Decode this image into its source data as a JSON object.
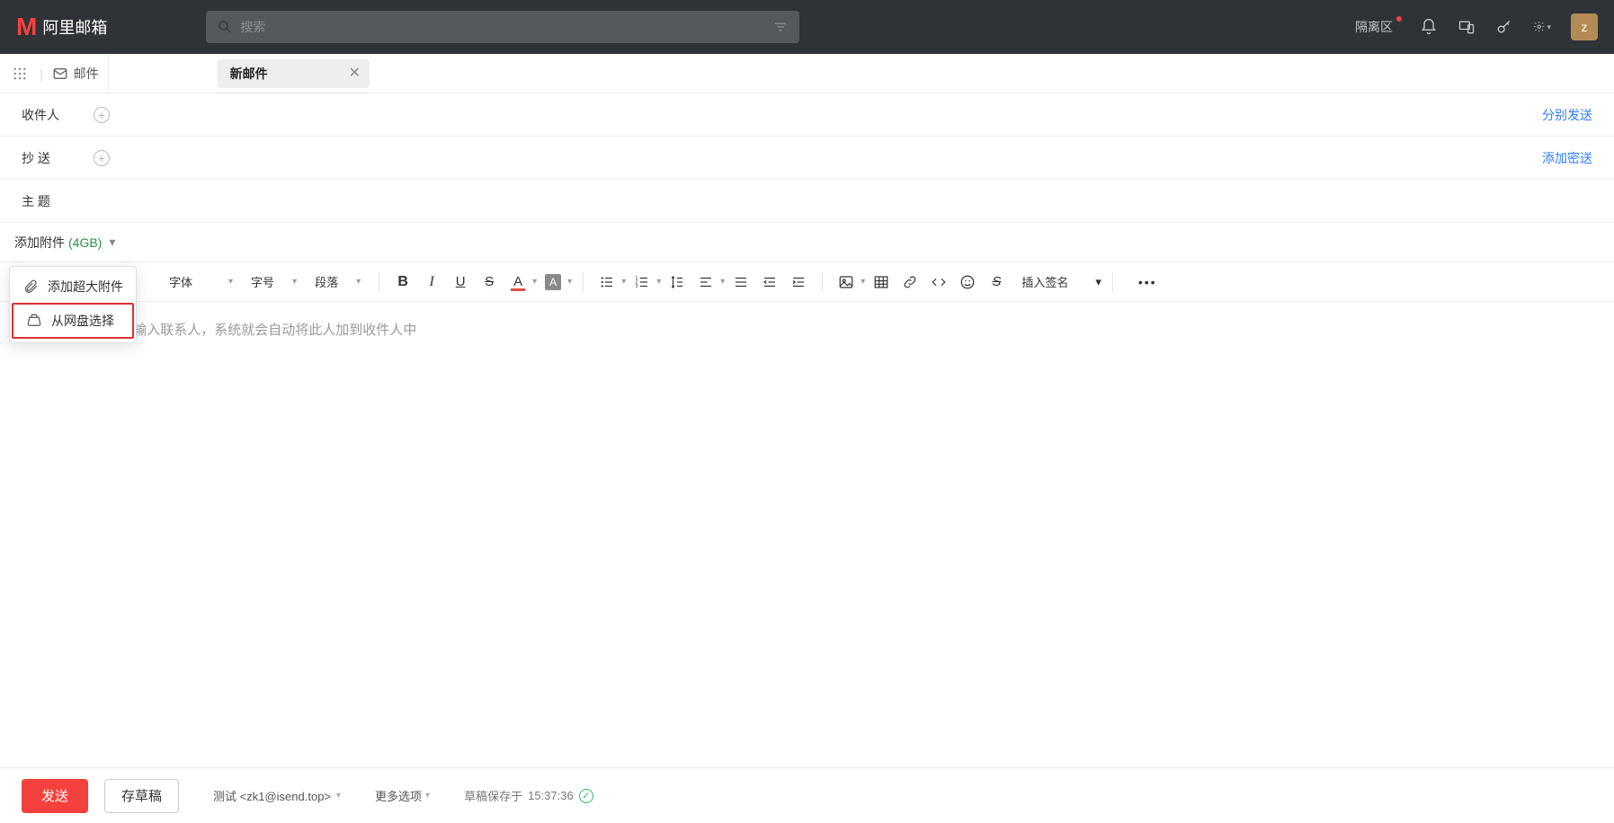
{
  "header": {
    "brand_text": "阿里邮箱",
    "search_placeholder": "搜索",
    "quarantine_label": "隔离区",
    "avatar_letter": "z"
  },
  "tabs": {
    "mail_label": "邮件",
    "compose_label": "新邮件"
  },
  "fields": {
    "to_label": "收件人",
    "cc_label": "抄 送",
    "subject_label": "主 题",
    "separate_send": "分别发送",
    "add_bcc": "添加密送"
  },
  "attachment": {
    "label": "添加附件",
    "size": "(4GB)",
    "menu_large": "添加超大附件",
    "menu_drive": "从网盘选择"
  },
  "toolbar": {
    "font_family": "字体",
    "font_size": "字号",
    "paragraph": "段落",
    "insert_signature": "插入签名"
  },
  "body": {
    "placeholder": "你只需要在@后面输入联系人，系统就会自动将此人加到收件人中"
  },
  "footer": {
    "send": "发送",
    "draft": "存草稿",
    "from": "测试 <zk1@isend.top>",
    "more_options": "更多选项",
    "draft_saved_prefix": "草稿保存于",
    "draft_saved_time": "15:37:36"
  }
}
